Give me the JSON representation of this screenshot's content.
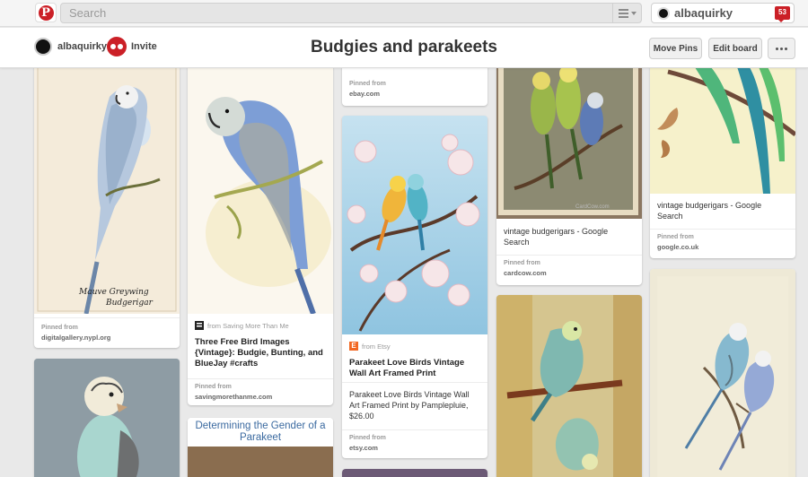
{
  "topbar": {
    "search_placeholder": "Search",
    "username": "albaquirky",
    "notifications": "53"
  },
  "board": {
    "owner": "albaquirky",
    "invite_label": "Invite",
    "title": "Budgies and parakeets",
    "move_pins_label": "Move Pins",
    "edit_board_label": "Edit board"
  },
  "pins": {
    "p1": {
      "caption_line1": "Mauve Greywing",
      "caption_line2": "Budgerigar",
      "pinned_from_label": "Pinned from",
      "domain": "digitalgallery.nypl.org"
    },
    "p2": {
      "source_prefix": "from Saving More Than Me",
      "title": "Three Free Bird Images {Vintage}: Budgie, Bunting, and BlueJay #crafts",
      "pinned_from_label": "Pinned from",
      "domain": "savingmorethanme.com"
    },
    "p3": {
      "heading": "Determining the Gender of a Parakeet"
    },
    "p4": {
      "pinned_from_label": "Pinned from",
      "domain": "ebay.com"
    },
    "p5": {
      "source_prefix": "from Etsy",
      "title": "Parakeet Love Birds Vintage Wall Art Framed Print",
      "description": "Parakeet Love Birds Vintage Wall Art Framed Print by Pamplepluie, $26.00",
      "pinned_from_label": "Pinned from",
      "domain": "etsy.com"
    },
    "p6": {
      "watermark": "CardCow.com",
      "description": "vintage budgerigars - Google Search",
      "pinned_from_label": "Pinned from",
      "domain": "cardcow.com"
    },
    "p7": {
      "description": "vintage budgerigars - Google Search",
      "pinned_from_label": "Pinned from",
      "domain": "google.co.uk"
    }
  },
  "colors": {
    "brand_red": "#cb2027",
    "etsy_orange": "#f26722"
  }
}
